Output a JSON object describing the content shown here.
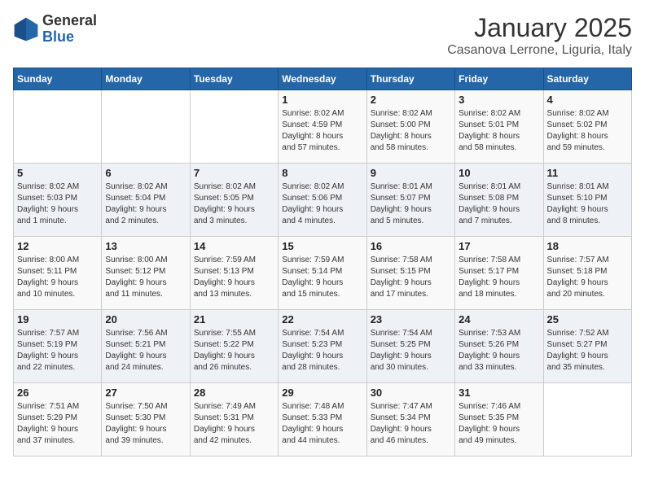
{
  "header": {
    "logo_general": "General",
    "logo_blue": "Blue",
    "month": "January 2025",
    "location": "Casanova Lerrone, Liguria, Italy"
  },
  "weekdays": [
    "Sunday",
    "Monday",
    "Tuesday",
    "Wednesday",
    "Thursday",
    "Friday",
    "Saturday"
  ],
  "weeks": [
    [
      {
        "day": "",
        "info": ""
      },
      {
        "day": "",
        "info": ""
      },
      {
        "day": "",
        "info": ""
      },
      {
        "day": "1",
        "info": "Sunrise: 8:02 AM\nSunset: 4:59 PM\nDaylight: 8 hours\nand 57 minutes."
      },
      {
        "day": "2",
        "info": "Sunrise: 8:02 AM\nSunset: 5:00 PM\nDaylight: 8 hours\nand 58 minutes."
      },
      {
        "day": "3",
        "info": "Sunrise: 8:02 AM\nSunset: 5:01 PM\nDaylight: 8 hours\nand 58 minutes."
      },
      {
        "day": "4",
        "info": "Sunrise: 8:02 AM\nSunset: 5:02 PM\nDaylight: 8 hours\nand 59 minutes."
      }
    ],
    [
      {
        "day": "5",
        "info": "Sunrise: 8:02 AM\nSunset: 5:03 PM\nDaylight: 9 hours\nand 1 minute."
      },
      {
        "day": "6",
        "info": "Sunrise: 8:02 AM\nSunset: 5:04 PM\nDaylight: 9 hours\nand 2 minutes."
      },
      {
        "day": "7",
        "info": "Sunrise: 8:02 AM\nSunset: 5:05 PM\nDaylight: 9 hours\nand 3 minutes."
      },
      {
        "day": "8",
        "info": "Sunrise: 8:02 AM\nSunset: 5:06 PM\nDaylight: 9 hours\nand 4 minutes."
      },
      {
        "day": "9",
        "info": "Sunrise: 8:01 AM\nSunset: 5:07 PM\nDaylight: 9 hours\nand 5 minutes."
      },
      {
        "day": "10",
        "info": "Sunrise: 8:01 AM\nSunset: 5:08 PM\nDaylight: 9 hours\nand 7 minutes."
      },
      {
        "day": "11",
        "info": "Sunrise: 8:01 AM\nSunset: 5:10 PM\nDaylight: 9 hours\nand 8 minutes."
      }
    ],
    [
      {
        "day": "12",
        "info": "Sunrise: 8:00 AM\nSunset: 5:11 PM\nDaylight: 9 hours\nand 10 minutes."
      },
      {
        "day": "13",
        "info": "Sunrise: 8:00 AM\nSunset: 5:12 PM\nDaylight: 9 hours\nand 11 minutes."
      },
      {
        "day": "14",
        "info": "Sunrise: 7:59 AM\nSunset: 5:13 PM\nDaylight: 9 hours\nand 13 minutes."
      },
      {
        "day": "15",
        "info": "Sunrise: 7:59 AM\nSunset: 5:14 PM\nDaylight: 9 hours\nand 15 minutes."
      },
      {
        "day": "16",
        "info": "Sunrise: 7:58 AM\nSunset: 5:15 PM\nDaylight: 9 hours\nand 17 minutes."
      },
      {
        "day": "17",
        "info": "Sunrise: 7:58 AM\nSunset: 5:17 PM\nDaylight: 9 hours\nand 18 minutes."
      },
      {
        "day": "18",
        "info": "Sunrise: 7:57 AM\nSunset: 5:18 PM\nDaylight: 9 hours\nand 20 minutes."
      }
    ],
    [
      {
        "day": "19",
        "info": "Sunrise: 7:57 AM\nSunset: 5:19 PM\nDaylight: 9 hours\nand 22 minutes."
      },
      {
        "day": "20",
        "info": "Sunrise: 7:56 AM\nSunset: 5:21 PM\nDaylight: 9 hours\nand 24 minutes."
      },
      {
        "day": "21",
        "info": "Sunrise: 7:55 AM\nSunset: 5:22 PM\nDaylight: 9 hours\nand 26 minutes."
      },
      {
        "day": "22",
        "info": "Sunrise: 7:54 AM\nSunset: 5:23 PM\nDaylight: 9 hours\nand 28 minutes."
      },
      {
        "day": "23",
        "info": "Sunrise: 7:54 AM\nSunset: 5:25 PM\nDaylight: 9 hours\nand 30 minutes."
      },
      {
        "day": "24",
        "info": "Sunrise: 7:53 AM\nSunset: 5:26 PM\nDaylight: 9 hours\nand 33 minutes."
      },
      {
        "day": "25",
        "info": "Sunrise: 7:52 AM\nSunset: 5:27 PM\nDaylight: 9 hours\nand 35 minutes."
      }
    ],
    [
      {
        "day": "26",
        "info": "Sunrise: 7:51 AM\nSunset: 5:29 PM\nDaylight: 9 hours\nand 37 minutes."
      },
      {
        "day": "27",
        "info": "Sunrise: 7:50 AM\nSunset: 5:30 PM\nDaylight: 9 hours\nand 39 minutes."
      },
      {
        "day": "28",
        "info": "Sunrise: 7:49 AM\nSunset: 5:31 PM\nDaylight: 9 hours\nand 42 minutes."
      },
      {
        "day": "29",
        "info": "Sunrise: 7:48 AM\nSunset: 5:33 PM\nDaylight: 9 hours\nand 44 minutes."
      },
      {
        "day": "30",
        "info": "Sunrise: 7:47 AM\nSunset: 5:34 PM\nDaylight: 9 hours\nand 46 minutes."
      },
      {
        "day": "31",
        "info": "Sunrise: 7:46 AM\nSunset: 5:35 PM\nDaylight: 9 hours\nand 49 minutes."
      },
      {
        "day": "",
        "info": ""
      }
    ]
  ]
}
